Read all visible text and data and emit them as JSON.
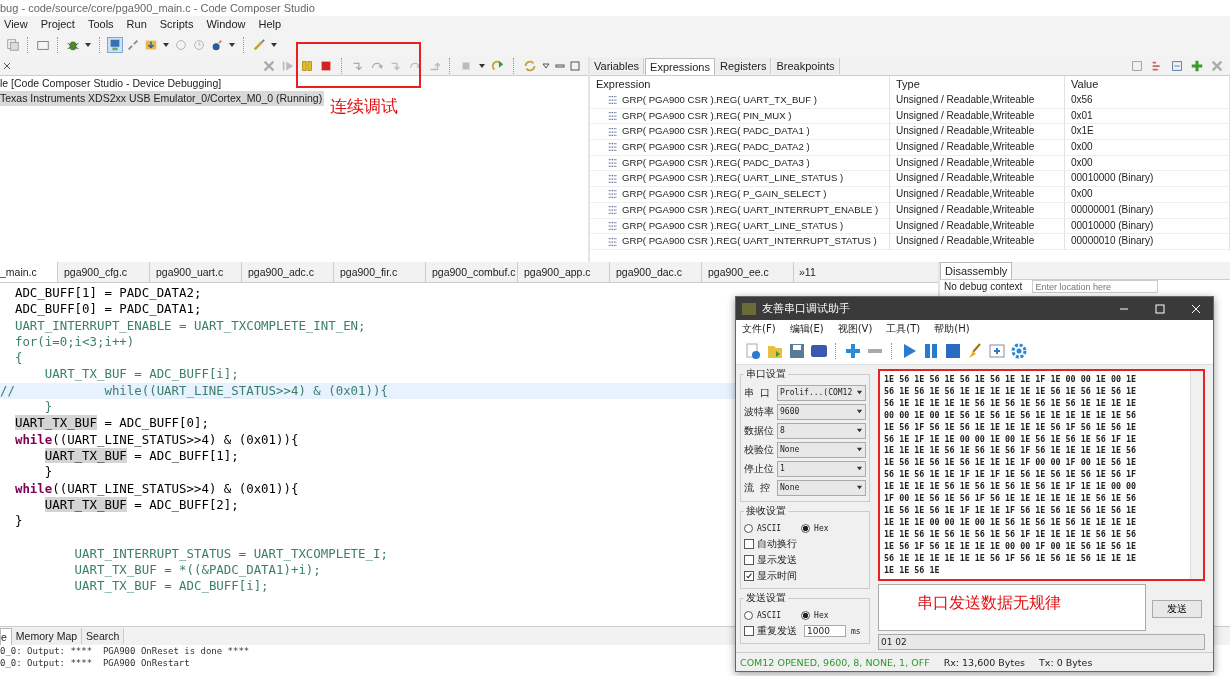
{
  "window": {
    "title": "bug - code/source/core/pga900_main.c - Code Composer Studio"
  },
  "menu": [
    "View",
    "Project",
    "Tools",
    "Run",
    "Scripts",
    "Window",
    "Help"
  ],
  "debug_view": {
    "lines": [
      {
        "text": "le [Code Composer Studio - Device Debugging]",
        "selected": false
      },
      {
        "text": "Texas Instruments XDS2xx USB Emulator_0/Cortex_M0_0 (Running)",
        "selected": true
      }
    ]
  },
  "annotations": [
    {
      "kind": "box_label",
      "text": "连续调试"
    },
    {
      "kind": "box_label",
      "text": "串口发送数据无规律"
    }
  ],
  "expressions": {
    "tabs": [
      {
        "label": "Variables",
        "selected": false
      },
      {
        "label": "Expressions",
        "selected": true
      },
      {
        "label": "Registers",
        "selected": false
      },
      {
        "label": "Breakpoints",
        "selected": false
      }
    ],
    "columns": [
      "Expression",
      "Type",
      "Value"
    ],
    "rows": [
      {
        "expression": "GRP( PGA900 CSR ).REG( UART_TX_BUF )",
        "type": "Unsigned / Readable,Writeable",
        "value": "0x56"
      },
      {
        "expression": "GRP( PGA900 CSR ).REG( PIN_MUX )",
        "type": "Unsigned / Readable,Writeable",
        "value": "0x01"
      },
      {
        "expression": "GRP( PGA900 CSR ).REG( PADC_DATA1 )",
        "type": "Unsigned / Readable,Writeable",
        "value": "0x1E"
      },
      {
        "expression": "GRP( PGA900 CSR ).REG( PADC_DATA2 )",
        "type": "Unsigned / Readable,Writeable",
        "value": "0x00"
      },
      {
        "expression": "GRP( PGA900 CSR ).REG( PADC_DATA3 )",
        "type": "Unsigned / Readable,Writeable",
        "value": "0x00"
      },
      {
        "expression": "GRP( PGA900 CSR ).REG( UART_LINE_STATUS )",
        "type": "Unsigned / Readable,Writeable",
        "value": "00010000 (Binary)"
      },
      {
        "expression": "GRP( PGA900 CSR ).REG( P_GAIN_SELECT )",
        "type": "Unsigned / Readable,Writeable",
        "value": "0x00"
      },
      {
        "expression": "GRP( PGA900 CSR ).REG( UART_INTERRUPT_ENABLE )",
        "type": "Unsigned / Readable,Writeable",
        "value": "00000001 (Binary)"
      },
      {
        "expression": "GRP( PGA900 CSR ).REG( UART_LINE_STATUS )",
        "type": "Unsigned / Readable,Writeable",
        "value": "00010000 (Binary)"
      },
      {
        "expression": "GRP( PGA900 CSR ).REG( UART_INTERRUPT_STATUS )",
        "type": "Unsigned / Readable,Writeable",
        "value": "00000010 (Binary)"
      }
    ]
  },
  "editor": {
    "tabs": [
      {
        "label": "_main.c",
        "selected": true
      },
      {
        "label": "pga900_cfg.c",
        "selected": false
      },
      {
        "label": "pga900_uart.c",
        "selected": false
      },
      {
        "label": "pga900_adc.c",
        "selected": false
      },
      {
        "label": "pga900_fir.c",
        "selected": false
      },
      {
        "label": "pga900_combuf.c",
        "selected": false
      },
      {
        "label": "pga900_app.c",
        "selected": false
      },
      {
        "label": "pga900_dac.c",
        "selected": false
      },
      {
        "label": "pga900_ee.c",
        "selected": false
      }
    ],
    "more_tabs": "»11",
    "lines": [
      {
        "inactive": false,
        "current": false,
        "parts": [
          {
            "kind": "plain",
            "text": "  ADC_BUFF[1] = PADC_DATA2;"
          }
        ]
      },
      {
        "inactive": false,
        "current": false,
        "parts": [
          {
            "kind": "plain",
            "text": "  ADC_BUFF[0] = PADC_DATA1;"
          }
        ]
      },
      {
        "inactive": true,
        "current": false,
        "parts": [
          {
            "kind": "plain",
            "text": "  UART_INTERRUPT_ENABLE = UART_TXCOMPLETE_INT_EN;"
          }
        ]
      },
      {
        "inactive": true,
        "current": false,
        "parts": [
          {
            "kind": "plain",
            "text": "  for(i=0;i<3;i++)"
          }
        ]
      },
      {
        "inactive": true,
        "current": false,
        "parts": [
          {
            "kind": "plain",
            "text": "  {"
          }
        ]
      },
      {
        "inactive": true,
        "current": false,
        "parts": [
          {
            "kind": "plain",
            "text": "      UART_TX_BUF = ADC_BUFF[i];"
          }
        ]
      },
      {
        "inactive": true,
        "current": true,
        "parts": [
          {
            "kind": "plain",
            "text": "//            while((UART_LINE_STATUS>>4) & (0x01)){"
          }
        ]
      },
      {
        "inactive": true,
        "current": false,
        "parts": [
          {
            "kind": "plain",
            "text": "      }"
          }
        ]
      },
      {
        "inactive": false,
        "current": false,
        "parts": [
          {
            "kind": "occurrence",
            "text": "  UART_TX_BUF"
          },
          {
            "kind": "plain",
            "text": " = ADC_BUFF[0];"
          }
        ]
      },
      {
        "inactive": false,
        "current": false,
        "parts": [
          {
            "kind": "keyword",
            "text": "  while"
          },
          {
            "kind": "plain",
            "text": "((UART_LINE_STATUS>>4) & (0x01)){"
          }
        ]
      },
      {
        "inactive": false,
        "current": false,
        "parts": [
          {
            "kind": "occurrence",
            "text": "      UART_TX_BUF"
          },
          {
            "kind": "plain",
            "text": " = ADC_BUFF[1];"
          }
        ]
      },
      {
        "inactive": false,
        "current": false,
        "parts": [
          {
            "kind": "plain",
            "text": "      }"
          }
        ]
      },
      {
        "inactive": false,
        "current": false,
        "parts": [
          {
            "kind": "keyword",
            "text": "  while"
          },
          {
            "kind": "plain",
            "text": "((UART_LINE_STATUS>>4) & (0x01)){"
          }
        ]
      },
      {
        "inactive": false,
        "current": false,
        "parts": [
          {
            "kind": "occurrence",
            "text": "      UART_TX_BUF"
          },
          {
            "kind": "plain",
            "text": " = ADC_BUFF[2];"
          }
        ]
      },
      {
        "inactive": false,
        "current": false,
        "parts": [
          {
            "kind": "plain",
            "text": "  }"
          }
        ]
      },
      {
        "current": false
      },
      {
        "inactive": true,
        "current": false,
        "parts": [
          {
            "kind": "plain",
            "text": "          UART_INTERRUPT_STATUS = UART_TXCOMPLETE_I;"
          }
        ]
      },
      {
        "inactive": true,
        "current": false,
        "parts": [
          {
            "kind": "plain",
            "text": "          UART_TX_BUF = *((&PADC_DATA1)+i);"
          }
        ]
      },
      {
        "inactive": true,
        "current": false,
        "parts": [
          {
            "kind": "plain",
            "text": "          UART_TX_BUF = ADC_BUFF[i];"
          }
        ]
      }
    ]
  },
  "disassembly": {
    "tab": "Disassembly",
    "message": "No debug context",
    "location_placeholder": "Enter location here"
  },
  "bottom": {
    "tabs": [
      {
        "label": "e",
        "selected": true
      },
      {
        "label": "Memory Map",
        "selected": false
      },
      {
        "label": "Search",
        "selected": false
      }
    ],
    "console": [
      "0_0: Output: ****  PGA900 OnReset is done ****",
      "0_0: Output: ****  PGA900 OnRestart"
    ]
  },
  "serial_tool": {
    "title": "友善串口调试助手",
    "menu": [
      "文件(F)",
      "编辑(E)",
      "视图(V)",
      "工具(T)",
      "帮助(H)"
    ],
    "port_settings": {
      "title": "串口设置",
      "fields": [
        {
          "label": "串  口",
          "value": "Prolif...(COM12"
        },
        {
          "label": "波特率",
          "value": "9600"
        },
        {
          "label": "数据位",
          "value": "8"
        },
        {
          "label": "校验位",
          "value": "None"
        },
        {
          "label": "停止位",
          "value": "1"
        },
        {
          "label": "流  控",
          "value": "None"
        }
      ]
    },
    "receive_settings": {
      "title": "接收设置",
      "modes": [
        {
          "label": "ASCII",
          "selected": false
        },
        {
          "label": "Hex",
          "selected": true
        }
      ],
      "options": [
        {
          "label": "自动换行",
          "checked": false
        },
        {
          "label": "显示发送",
          "checked": false
        },
        {
          "label": "显示时间",
          "checked": true
        }
      ]
    },
    "send_settings": {
      "title": "发送设置",
      "modes": [
        {
          "label": "ASCII",
          "selected": false
        },
        {
          "label": "Hex",
          "selected": true
        }
      ],
      "repeat": {
        "label": "重复发送",
        "checked": false
      },
      "interval": "1000",
      "unit": "ms"
    },
    "received": "1E 56 1E 56 1E 56 1E 56 1E 1E 1F 1E 00 00 1E 00 1E\n56 1E 56 1E 56 1E 1E 1E 1E 1E 1E 56 1E 56 1E 56 1E\n56 1E 1E 1E 1E 1E 56 1E 56 1E 56 1E 56 1E 1E 1E 1E\n00 00 1E 00 1E 56 1E 56 1E 56 1E 1E 1E 1E 1E 1E 56\n1E 56 1F 56 1E 56 1E 1E 1E 1E 1E 56 1F 56 1E 56 1E\n56 1E 1F 1E 1E 00 00 1E 00 1E 56 1E 56 1E 56 1F 1E\n1E 1E 1E 1E 56 1E 56 1E 56 1F 56 1E 1E 1E 1E 1E 56\n1E 56 1E 56 1E 56 1E 1E 1E 1F 00 00 1F 00 1E 56 1E\n56 1E 56 1E 1E 1F 1E 1F 1E 56 1E 56 1E 56 1E 56 1F\n1E 1E 1E 1E 56 1E 56 1E 56 1E 56 1E 1F 1E 1E 00 00\n1F 00 1E 56 1E 56 1F 56 1E 1E 1E 1E 1E 1E 56 1E 56\n1E 56 1E 56 1E 1F 1E 1E 1F 56 1E 56 1E 56 1E 56 1E\n1E 1E 1E 00 00 1E 00 1E 56 1E 56 1E 56 1E 1E 1E 1E\n1E 1E 56 1E 56 1E 56 1E 56 1F 1E 1E 1E 1E 56 1E 56\n1E 56 1F 56 1E 1E 1E 1E 00 00 1F 00 1E 56 1E 56 1E\n56 1E 1E 1E 1E 1E 1E 56 1F 56 1E 56 1E 56 1E 1E 1E\n1E 1E 56 1E",
    "send_button": "发送",
    "send_history": "01 02",
    "status": {
      "connection": "COM12 OPENED, 9600, 8, NONE, 1, OFF",
      "rx": "Rx: 13,600 Bytes",
      "tx": "Tx: 0 Bytes"
    }
  }
}
